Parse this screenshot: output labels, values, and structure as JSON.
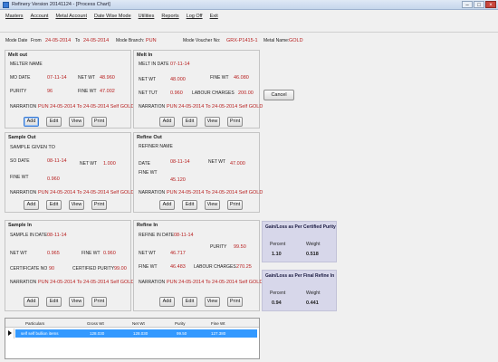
{
  "window": {
    "title": "Refinery Version 20141124 - [Process Chart]"
  },
  "menu": [
    "Masters",
    "Account",
    "Metal Account",
    "Date Wise Mode",
    "Utilities",
    "Reports",
    "Log Off",
    "Exit"
  ],
  "header": {
    "mode_date_label": "Mode Date",
    "from_label": "From",
    "from_value": "24-05-2014",
    "to_label": "To",
    "to_value": "24-05-2014",
    "branch_label": "Mode Branch:",
    "branch_value": "PUN",
    "voucher_label": "Mode Voucher No:",
    "voucher_value": "GRX-P1415-1",
    "metal_label": "Metal Name:",
    "metal_value": "GOLD"
  },
  "buttons": {
    "add": "Add",
    "edit": "Edit",
    "view": "View",
    "print": "Print",
    "cancel": "Cancel"
  },
  "melt_out": {
    "title": "Melt out",
    "melter_label": "MELTER NAME",
    "mo_date_label": "MO DATE",
    "mo_date": "07-11-14",
    "net_wt_label": "NET WT",
    "net_wt": "48.960",
    "purity_label": "PURITY",
    "purity": "96",
    "fine_wt_label": "FINE WT",
    "fine_wt": "47.002",
    "narration_label": "NARRATION",
    "narration": "PUN 24-05-2014 To 24-05-2014 Self GOLD"
  },
  "melt_in": {
    "title": "Melt In",
    "date_label": "MELT IN DATE",
    "date": "07-11-14",
    "net_wt_label": "NET WT",
    "net_wt": "48.000",
    "fine_wt_label": "FINE WT",
    "fine_wt": "46.080",
    "net_tut_label": "NET TUT",
    "net_tut": "0.960",
    "labour_label": "LABOUR CHARGES",
    "labour": "200.00",
    "narration_label": "NARRATION",
    "narration": "PUN 24-05-2014 To 24-05-2014 Self GOLD"
  },
  "sample_out": {
    "title": "Sample Out",
    "given_label": "SAMPLE GIVEN TO",
    "date_label": "SO DATE",
    "date": "08-11-14",
    "net_wt_label": "NET WT",
    "net_wt": "1.000",
    "fine_wt_label": "FINE WT",
    "fine_wt": "0.960",
    "narration_label": "NARRATION",
    "narration": "PUN 24-05-2014 To 24-05-2014 Self GOLD"
  },
  "refine_out": {
    "title": "Refine Out",
    "refiner_label": "REFINER NAME",
    "date_label": "DATE",
    "date": "08-11-14",
    "net_wt_label": "NET WT",
    "net_wt": "47.000",
    "fine_wt_label": "FINE WT",
    "fine_wt": "45.120",
    "narration_label": "NARRATION",
    "narration": "PUN 24-05-2014 To 24-05-2014 Self GOLD"
  },
  "sample_in": {
    "title": "Sample In",
    "date_label": "SAMPLE IN DATE",
    "date": "08-11-14",
    "net_wt_label": "NET WT",
    "net_wt": "0.965",
    "fine_wt_label": "FINE WT",
    "fine_wt": "0.960",
    "cert_label": "CERTIFICATE NO",
    "cert": "90",
    "cert_purity_label": "CERTIFIED PURITY",
    "cert_purity": "99.00",
    "narration_label": "NARRATION",
    "narration": "PUN 24-05-2014 To 24-05-2014 Self GOLD"
  },
  "refine_in": {
    "title": "Refine In",
    "date_label": "REFINE IN DATE",
    "date": "08-11-14",
    "purity_label": "PURITY",
    "purity": "99.50",
    "net_wt_label": "NET WT",
    "net_wt": "46.717",
    "fine_wt_label": "FINE WT",
    "fine_wt": "46.483",
    "labour_label": "LABOUR CHARGES",
    "labour": "270.25",
    "narration_label": "NARRATION",
    "narration": "PUN 24-05-2014 To 24-05-2014 Self GOLD"
  },
  "gain_certified": {
    "title": "Gain/Loss as Per Certified Purity",
    "percent_label": "Percent",
    "weight_label": "Weight",
    "percent": "1.10",
    "weight": "0.518"
  },
  "gain_final": {
    "title": "Gain/Loss as Per Final Refine In",
    "percent_label": "Percent",
    "weight_label": "Weight",
    "percent": "0.94",
    "weight": "0.441"
  },
  "grid": {
    "columns": [
      "Particulars",
      "Gross Wt",
      "Net Wt",
      "Purity",
      "Fine Wt"
    ],
    "rows": [
      {
        "particulars": "self self bullion items",
        "gross": "128.030",
        "net": "128.030",
        "purity": "99.50",
        "fine": "127.380"
      }
    ]
  }
}
